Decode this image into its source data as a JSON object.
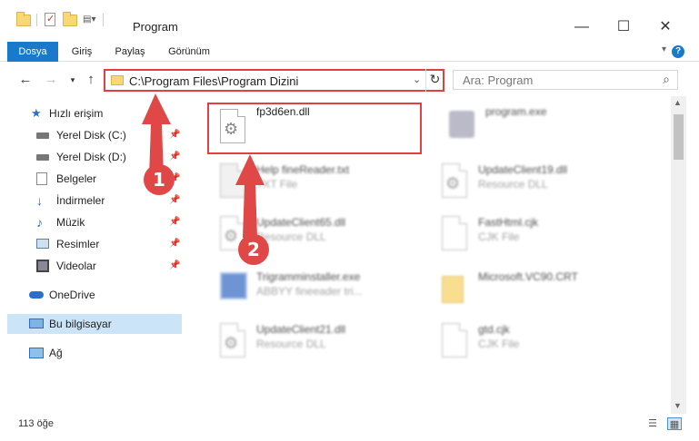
{
  "window": {
    "title": "Program",
    "minimize": "—",
    "maximize": "☐",
    "close": "✕"
  },
  "ribbon": {
    "tabs": [
      "Dosya",
      "Giriş",
      "Paylaş",
      "Görünüm"
    ],
    "active_tab": "Dosya",
    "help": "?"
  },
  "address": {
    "path": "C:\\Program Files\\Program Dizini"
  },
  "search": {
    "placeholder": "Ara: Program"
  },
  "nav": {
    "items": [
      {
        "label": "Hızlı erişim",
        "icon": "star-icon"
      },
      {
        "label": "Yerel Disk (C:)",
        "icon": "drive-icon",
        "pinned": true
      },
      {
        "label": "Yerel Disk (D:)",
        "icon": "drive-icon",
        "pinned": true
      },
      {
        "label": "Belgeler",
        "icon": "documents-icon",
        "pinned": true
      },
      {
        "label": "İndirmeler",
        "icon": "download-icon",
        "pinned": true
      },
      {
        "label": "Müzik",
        "icon": "music-icon",
        "pinned": true
      },
      {
        "label": "Resimler",
        "icon": "pictures-icon",
        "pinned": true
      },
      {
        "label": "Videolar",
        "icon": "videos-icon",
        "pinned": true
      },
      {
        "label": "OneDrive",
        "icon": "cloud-icon"
      },
      {
        "label": "Bu bilgisayar",
        "icon": "computer-icon",
        "selected": true
      },
      {
        "label": "Ağ",
        "icon": "network-icon"
      }
    ]
  },
  "files": [
    {
      "name": "fp3d6en.dll",
      "type": ""
    },
    {
      "name": "program.exe",
      "type": ""
    },
    {
      "name": "Help fineReader.txt",
      "type": "TXT File"
    },
    {
      "name": "UpdateClient19.dll",
      "type": "Resource DLL"
    },
    {
      "name": "UpdateClient65.dll",
      "type": "Resource DLL"
    },
    {
      "name": "FastHtml.cjk",
      "type": "CJK File"
    },
    {
      "name": "Trigramminstaller.exe",
      "type": "ABBYY fineeader tri..."
    },
    {
      "name": "Microsoft.VC90.CRT",
      "type": ""
    },
    {
      "name": "UpdateClient21.dll",
      "type": "Resource DLL"
    },
    {
      "name": "gtd.cjk",
      "type": "CJK File"
    }
  ],
  "annotations": {
    "badge1": "1",
    "badge2": "2",
    "color": "#e04848"
  },
  "status": {
    "count": "113 öğe"
  }
}
